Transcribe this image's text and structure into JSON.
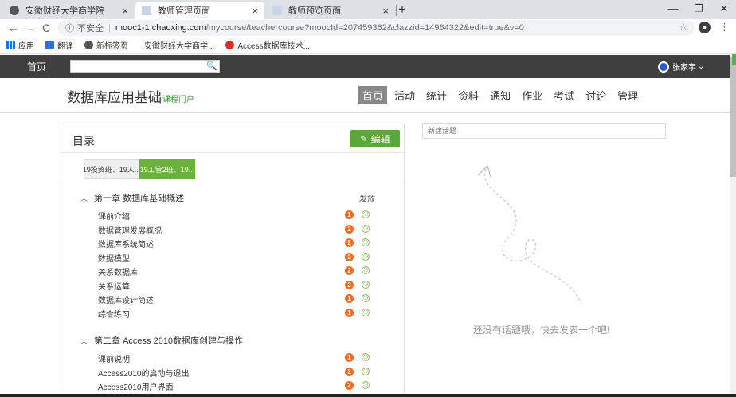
{
  "browser": {
    "tabs": [
      {
        "title": "安徽财经大学商学院",
        "active": false
      },
      {
        "title": "教师管理页面",
        "active": true
      },
      {
        "title": "教师预览页面",
        "active": false
      }
    ],
    "new_tab": "+",
    "close": "×",
    "win": {
      "min": "—",
      "max": "❐",
      "close": "✕"
    },
    "nav": {
      "back": "←",
      "forward": "→",
      "reload": "C"
    },
    "security_label": "不安全",
    "url_host": "mooc1-1.chaoxing.com",
    "url_path": "/mycourse/teachercourse?moocId=207459362&clazzid=14964322&edit=true&v=0",
    "star": "☆",
    "menu": "⋮",
    "bookmarks": [
      {
        "label": "应用",
        "icon": "apps-grid-icon"
      },
      {
        "label": "翻译",
        "icon": "translate-icon"
      },
      {
        "label": "新标签页",
        "icon": "globe-icon"
      },
      {
        "label": "安徽财经大学商学...",
        "icon": "page-icon"
      },
      {
        "label": "Access数据库技术...",
        "icon": "access-icon"
      }
    ]
  },
  "site": {
    "home": "首页",
    "search_placeholder": "",
    "search_icon": "🔍",
    "user_name": "张家宇",
    "user_caret": "⌄"
  },
  "course": {
    "title": "数据库应用基础",
    "portal": "课程门户",
    "nav": [
      {
        "label": "首页",
        "active": true
      },
      {
        "label": "活动",
        "active": false
      },
      {
        "label": "统计",
        "active": false
      },
      {
        "label": "资料",
        "active": false
      },
      {
        "label": "通知",
        "active": false
      },
      {
        "label": "作业",
        "active": false
      },
      {
        "label": "考试",
        "active": false
      },
      {
        "label": "讨论",
        "active": false
      },
      {
        "label": "管理",
        "active": false
      }
    ]
  },
  "catalog": {
    "title": "目录",
    "edit_label": "编辑",
    "class_tabs": [
      {
        "label": "19投资班、19人...",
        "active": false
      },
      {
        "label": "19工管2班、19...",
        "active": true
      }
    ],
    "publish_header": "发放",
    "chapters": [
      {
        "title": "第一章 数据库基础概述",
        "lessons": [
          {
            "title": "课前介绍",
            "count": "1"
          },
          {
            "title": "数据管理发展概况",
            "count": "2"
          },
          {
            "title": "数据库系统简述",
            "count": "2"
          },
          {
            "title": "数据模型",
            "count": "2"
          },
          {
            "title": "关系数据库",
            "count": "2"
          },
          {
            "title": "关系运算",
            "count": "2"
          },
          {
            "title": "数据库设计简述",
            "count": "1"
          },
          {
            "title": "综合练习",
            "count": "1"
          }
        ]
      },
      {
        "title": "第二章 Access 2010数据库创建与操作",
        "lessons": [
          {
            "title": "课前说明",
            "count": "1"
          },
          {
            "title": "Access2010的启动与退出",
            "count": "2"
          },
          {
            "title": "Access2010用户界面",
            "count": "2"
          }
        ]
      }
    ]
  },
  "topics": {
    "new_topic_placeholder": "新建话题",
    "empty_text": "还没有话题哦，快去发表一个吧!"
  }
}
